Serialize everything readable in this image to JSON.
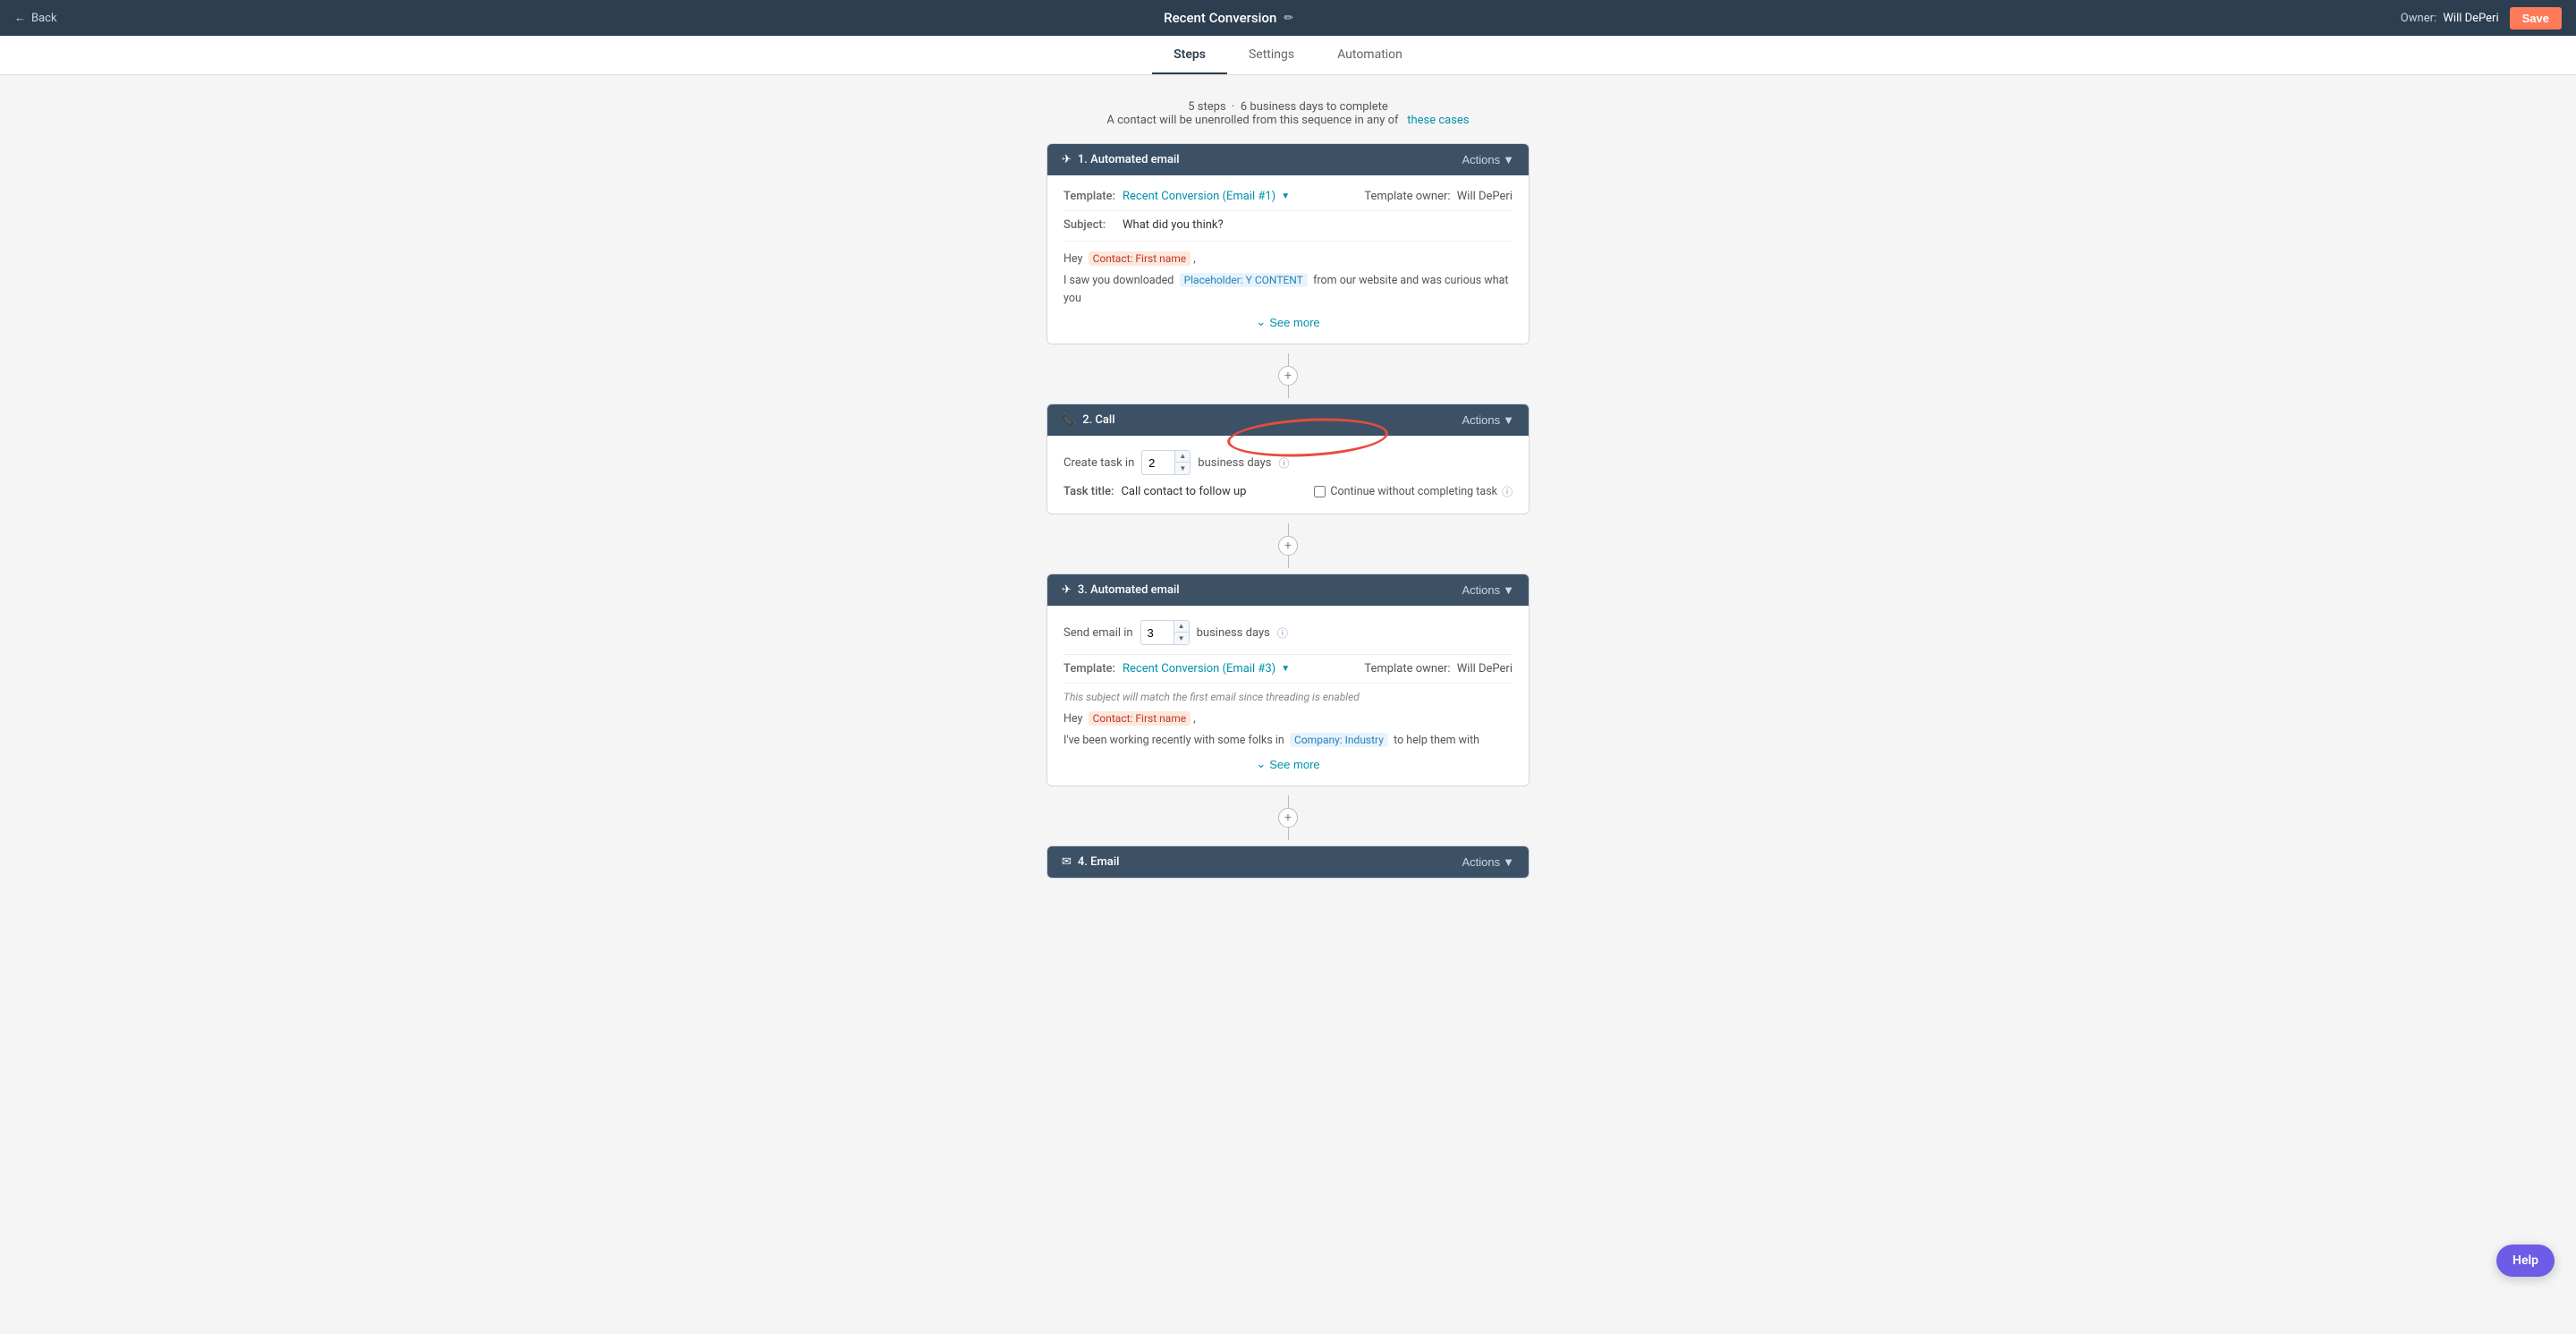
{
  "topNav": {
    "backLabel": "Back",
    "title": "Recent Conversion",
    "editIconLabel": "✏",
    "ownerLabel": "Owner:",
    "ownerName": "Will DePeri",
    "saveLabel": "Save"
  },
  "tabs": [
    {
      "id": "steps",
      "label": "Steps",
      "active": true
    },
    {
      "id": "settings",
      "label": "Settings",
      "active": false
    },
    {
      "id": "automation",
      "label": "Automation",
      "active": false
    }
  ],
  "summary": {
    "stepsCount": "5 steps",
    "daysLabel": "6 business days to complete",
    "unenrollText": "A contact will be unenrolled from this sequence in any of",
    "theseCasesLabel": "these cases"
  },
  "step1": {
    "headerIcon": "✈",
    "headerTitle": "1. Automated email",
    "actionsLabel": "Actions",
    "templateLabel": "Template:",
    "templateLink": "Recent Conversion (Email #1)",
    "templateOwnerLabel": "Template owner:",
    "templateOwnerValue": "Will DePeri",
    "subjectLabel": "Subject:",
    "subjectValue": "What did you think?",
    "bodyLine1Prefix": "Hey",
    "bodyToken1": "Contact: First name",
    "bodyLine2Prefix": "I saw you downloaded",
    "bodyToken2": "Placeholder: Y CONTENT",
    "bodyLine2Suffix": "from our website and was curious what you",
    "seeMoreLabel": "See more"
  },
  "step2": {
    "headerIcon": "📞",
    "headerTitle": "2. Call",
    "actionsLabel": "Actions",
    "createTaskLabel": "Create task in",
    "numberValue": "2",
    "businessDaysLabel": "business days",
    "taskTitleLabel": "Task title:",
    "taskTitleValue": "Call contact to follow up",
    "continueLabel": "Continue without completing task"
  },
  "step3": {
    "headerIcon": "✈",
    "headerTitle": "3. Automated email",
    "actionsLabel": "Actions",
    "sendEmailLabel": "Send email in",
    "numberValue": "3",
    "businessDaysLabel": "business days",
    "templateLabel": "Template:",
    "templateLink": "Recent Conversion (Email #3)",
    "templateOwnerLabel": "Template owner:",
    "templateOwnerValue": "Will DePeri",
    "threadNote": "This subject will match the first email since threading is enabled",
    "bodyLine1Prefix": "Hey",
    "bodyToken1": "Contact: First name",
    "bodyLine2Prefix": "I've been working recently with some folks in",
    "bodyToken2": "Company: Industry",
    "bodyLine2Suffix": "to help them with",
    "seeMoreLabel": "See more"
  },
  "step4": {
    "headerIcon": "✉",
    "headerTitle": "4. Email",
    "actionsLabel": "Actions"
  },
  "helpButton": {
    "label": "Help"
  },
  "connectorPlus": "+"
}
